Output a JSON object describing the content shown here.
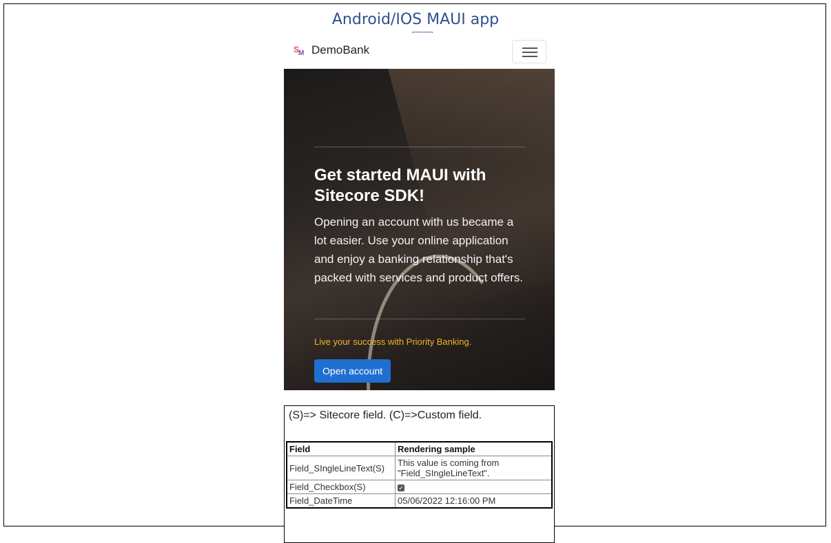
{
  "caption": "Android/IOS MAUI app",
  "navbar": {
    "logo": {
      "s": "S",
      "m": "M"
    },
    "brand": "DemoBank",
    "menu_icon": "hamburger-menu-icon"
  },
  "hero": {
    "title": "Get started MAUI with Sitecore SDK!",
    "body": "Opening an account with us became a lot easier. Use your online application and enjoy a banking relationship that's packed with services and product offers.",
    "tagline": "Live your success with Priority Banking.",
    "button_label": "Open account",
    "colors": {
      "tagline": "#f0b429",
      "button": "#1f6fd1"
    }
  },
  "fields": {
    "legend": "(S)=> Sitecore field. (C)=>Custom field.",
    "headers": [
      "Field",
      "Rendering sample"
    ],
    "rows": [
      {
        "field": "Field_SIngleLineText(S)",
        "sample": "This value is coming from \"Field_SIngleLineText\"."
      },
      {
        "field": "Field_Checkbox(S)",
        "sample": "",
        "checkbox_icon": "checked-checkbox-icon"
      },
      {
        "field": "Field_DateTime",
        "sample": "05/06/2022 12:16:00 PM"
      }
    ]
  }
}
